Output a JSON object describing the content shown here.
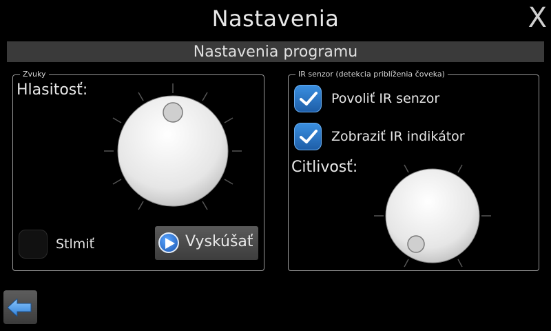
{
  "header": {
    "title": "Nastavenia",
    "close_label": "X"
  },
  "section": {
    "title": "Nastavenia programu"
  },
  "sounds": {
    "legend": "Zvuky",
    "volume_label": "Hlasitosť:",
    "mute_label": "Stlmiť",
    "mute_checked": false,
    "test_button_label": "Vyskúšať"
  },
  "ir": {
    "legend": "IR senzor (detekcia priblíženia čoveka)",
    "enable_label": "Povoliť IR senzor",
    "enable_checked": true,
    "indicator_label": "Zobraziť IR indikátor",
    "indicator_checked": true,
    "sensitivity_label": "Citlivosť:"
  },
  "icons": {
    "close": "close-icon",
    "back": "arrow-left-icon",
    "play": "play-icon",
    "check": "checkmark-icon"
  },
  "colors": {
    "accent": "#2f7fd6",
    "section_bar": "#3a3a3a",
    "group_border": "#9a9a9a"
  }
}
